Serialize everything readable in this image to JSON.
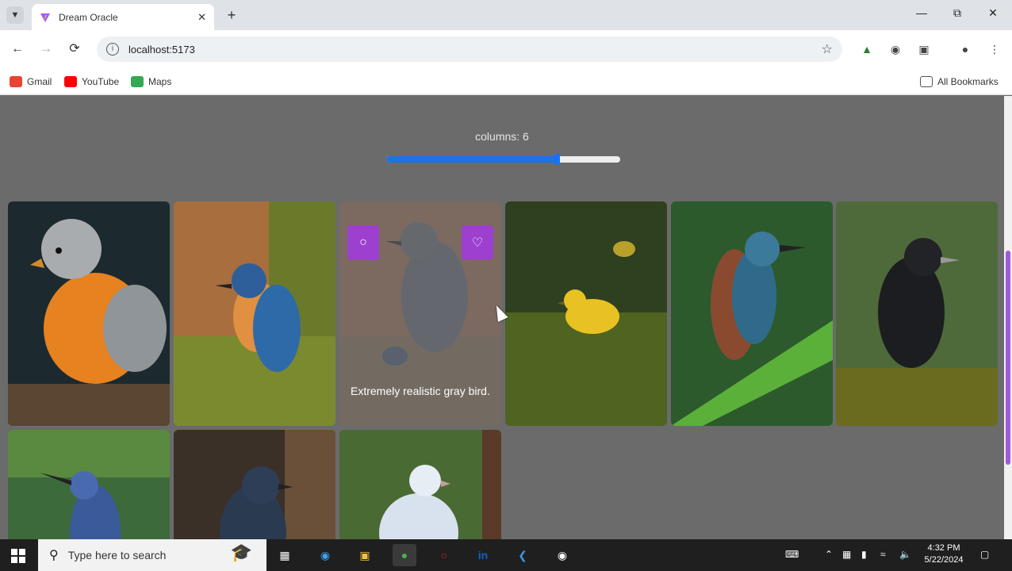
{
  "browser": {
    "tab_title": "Dream Oracle",
    "url": "localhost:5173",
    "bookmarks": [
      {
        "label": "Gmail",
        "color": "#ea4335"
      },
      {
        "label": "YouTube",
        "color": "#ff0000"
      },
      {
        "label": "Maps",
        "color": "#34a853"
      }
    ],
    "all_bookmarks": "All Bookmarks"
  },
  "gallery": {
    "columns_label": "columns: 6",
    "columns_value": 6,
    "slider_fraction": 0.73,
    "hover_caption": "Extremely realistic gray bird.",
    "accent": "#9d3fcf",
    "slider_color": "#1a73e8"
  },
  "taskbar": {
    "search_placeholder": "Type here to search",
    "time": "4:32 PM",
    "date": "5/22/2024"
  }
}
